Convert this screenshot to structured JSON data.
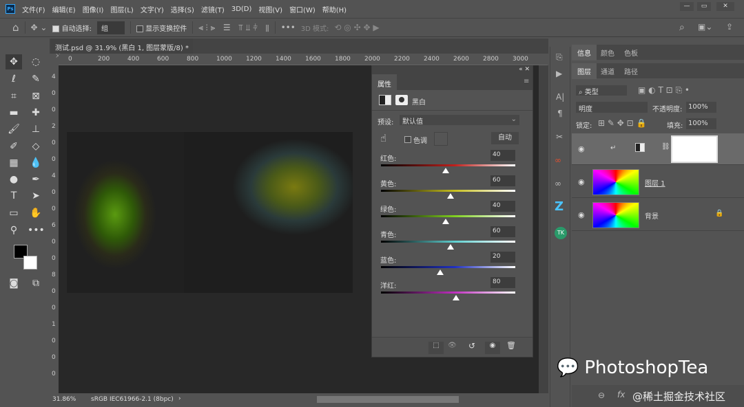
{
  "app": {
    "logo": "Ps"
  },
  "menu": [
    "文件(F)",
    "编辑(E)",
    "图像(I)",
    "图层(L)",
    "文字(Y)",
    "选择(S)",
    "滤镜(T)",
    "3D(D)",
    "视图(V)",
    "窗口(W)",
    "帮助(H)"
  ],
  "window_controls": {
    "minimize": "—",
    "restore": "▭",
    "close": "✕"
  },
  "options": {
    "auto_select_label": "自动选择:",
    "auto_select_checked": true,
    "auto_select_value": "组",
    "show_transform_label": "显示变换控件",
    "show_transform_checked": false,
    "mode_3d": "3D 模式:",
    "more": "•••"
  },
  "document_tab": {
    "title": "测试.psd @ 31.9% (黑白 1, 图层蒙版/8) *",
    "close": "×"
  },
  "ruler_h": [
    "0",
    "200",
    "400",
    "600",
    "800",
    "1000",
    "1200",
    "1400",
    "1600",
    "1800",
    "2000",
    "2200",
    "2400",
    "2600",
    "2800",
    "3000"
  ],
  "ruler_v": [
    "4",
    "0",
    "0",
    "2",
    "0",
    "0",
    "4",
    "0",
    "0",
    "6",
    "0",
    "0",
    "8",
    "0",
    "0",
    "1",
    "0",
    "0",
    "0"
  ],
  "status": {
    "zoom": "31.86%",
    "profile": "sRGB IEC61966-2.1 (8bpc)",
    "arrow": "›"
  },
  "properties": {
    "tab": "属性",
    "adjustment_name": "黑白",
    "preset_label": "预设:",
    "preset_value": "默认值",
    "tint_label": "色调",
    "tint_checked": false,
    "auto_button": "自动",
    "slider_range": [
      -200,
      300
    ],
    "sliders": [
      {
        "label": "红色:",
        "value": 40,
        "color": "#c0201c"
      },
      {
        "label": "黄色:",
        "value": 60,
        "color": "#c8c020"
      },
      {
        "label": "绿色:",
        "value": 40,
        "color": "#80d020"
      },
      {
        "label": "青色:",
        "value": 60,
        "color": "#60d0d0"
      },
      {
        "label": "蓝色:",
        "value": 20,
        "color": "#2030c0"
      },
      {
        "label": "洋红:",
        "value": 80,
        "color": "#c030c0"
      }
    ]
  },
  "right_panels": {
    "top_tabs": [
      "信息",
      "颜色",
      "色板"
    ],
    "layer_tabs": [
      "图层",
      "通道",
      "路径"
    ],
    "filter_kind": "类型",
    "blend_mode": "明度",
    "opacity_label": "不透明度:",
    "opacity": "100%",
    "lock_label": "锁定:",
    "fill_label": "填充:",
    "fill": "100%",
    "layers": [
      {
        "name": "",
        "type": "adjustment",
        "selected": true
      },
      {
        "name": "图层 1",
        "type": "pixel",
        "selected": false
      },
      {
        "name": "背景",
        "type": "background",
        "selected": false,
        "locked": true
      }
    ],
    "bottom_icons": [
      "link-icon",
      "fx-icon"
    ]
  },
  "watermark": {
    "brand": "PhotoshopTea",
    "community": "@稀土掘金技术社区"
  }
}
